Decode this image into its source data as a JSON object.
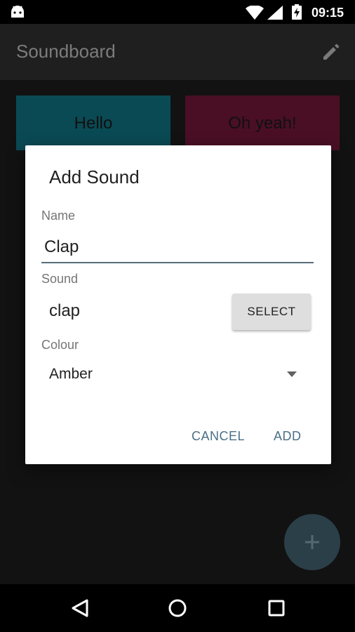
{
  "status_bar": {
    "time": "09:15",
    "icons": [
      "android-icon",
      "wifi-icon",
      "signal-icon",
      "battery-charging-icon"
    ]
  },
  "app_bar": {
    "title": "Soundboard",
    "action_icon": "edit-icon"
  },
  "tiles": [
    {
      "label": "Hello",
      "color": "#0a4a54"
    },
    {
      "label": "Oh yeah!",
      "color": "#4a0f25"
    }
  ],
  "fab": {
    "icon": "plus-icon"
  },
  "dialog": {
    "title": "Add Sound",
    "name_label": "Name",
    "name_value": "Clap",
    "sound_label": "Sound",
    "sound_value": "clap",
    "select_label": "SELECT",
    "colour_label": "Colour",
    "colour_value": "Amber",
    "cancel_label": "CANCEL",
    "add_label": "ADD"
  },
  "colors": {
    "accent": "#4a6f86",
    "dialog_bg": "#ffffff"
  },
  "nav_bar": {
    "icons": [
      "back-icon",
      "home-icon",
      "recents-icon"
    ]
  }
}
